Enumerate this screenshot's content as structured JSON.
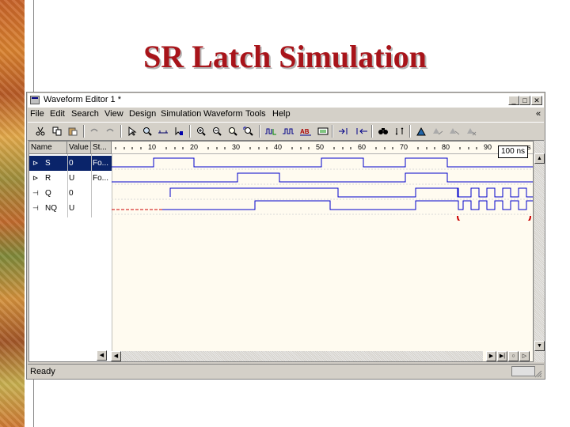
{
  "slide": {
    "title": "SR Latch Simulation"
  },
  "window": {
    "title": "Waveform Editor 1 *",
    "controls": {
      "minimize": "_",
      "maximize": "□",
      "close": "✕",
      "chevron": "«"
    }
  },
  "menu": [
    "File",
    "Edit",
    "Search",
    "View",
    "Design",
    "Simulation",
    "Waveform",
    "Tools",
    "Help"
  ],
  "toolbar_icons": [
    "cut-icon",
    "copy-icon",
    "paste-icon",
    "undo-icon",
    "redo-icon",
    "select-icon",
    "zoom-icon",
    "ruler-icon",
    "cursor-icon",
    "zoom-in-icon",
    "zoom-out-icon",
    "zoom-fit-icon",
    "zoom-area-icon",
    "clock-icon",
    "wave-icon",
    "formula-icon",
    "hotkey-icon",
    "step-icon",
    "run-icon",
    "find-icon",
    "goto-icon",
    "bookmark-icon",
    "prev-bookmark-icon",
    "next-bookmark-icon"
  ],
  "columns": {
    "name": "Name",
    "value": "Value",
    "stimulator": "St..."
  },
  "ruler": {
    "ticks": [
      "10",
      "20",
      "30",
      "40",
      "50",
      "60",
      "70",
      "80",
      "90"
    ],
    "unit": "ns",
    "cursor_time": "100 ns"
  },
  "signals": [
    {
      "name": "S",
      "value": "0",
      "stimulator": "Fo...",
      "type": "input"
    },
    {
      "name": "R",
      "value": "U",
      "stimulator": "Fo...",
      "type": "input"
    },
    {
      "name": "Q",
      "value": "0",
      "stimulator": "",
      "type": "output"
    },
    {
      "name": "NQ",
      "value": "U",
      "stimulator": "",
      "type": "output"
    }
  ],
  "status": {
    "text": "Ready"
  },
  "colors": {
    "accent_title": "#a8141a",
    "selection": "#0a246a",
    "wave": "#0000cc",
    "brace": "#cc0000",
    "panel_bg": "#fffbf0"
  }
}
